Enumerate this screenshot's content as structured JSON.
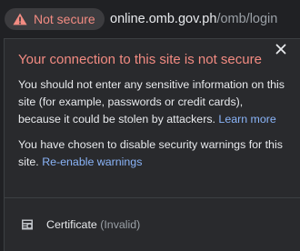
{
  "address_bar": {
    "security_chip_label": "Not secure",
    "url_host": "online.omb.gov.ph",
    "url_path": "/omb/login"
  },
  "popup": {
    "title": "Your connection to this site is not secure",
    "warning_text": "You should not enter any sensitive information on this site (for example, passwords or credit cards), because it could be stolen by attackers.",
    "learn_more_link": "Learn more",
    "disabled_warnings_text": "You have chosen to disable security warnings for this site.",
    "reenable_link": "Re-enable warnings",
    "certificate_label": "Certificate",
    "certificate_status": "(Invalid)"
  },
  "icons": {
    "warning": "warning-triangle-icon",
    "close": "close-icon",
    "certificate": "certificate-icon"
  },
  "colors": {
    "background": "#202124",
    "popup_background": "#292a2d",
    "danger_text": "#f28b82",
    "link": "#8ab4f8",
    "primary_text": "#e8eaed",
    "secondary_text": "#9aa0a6"
  }
}
